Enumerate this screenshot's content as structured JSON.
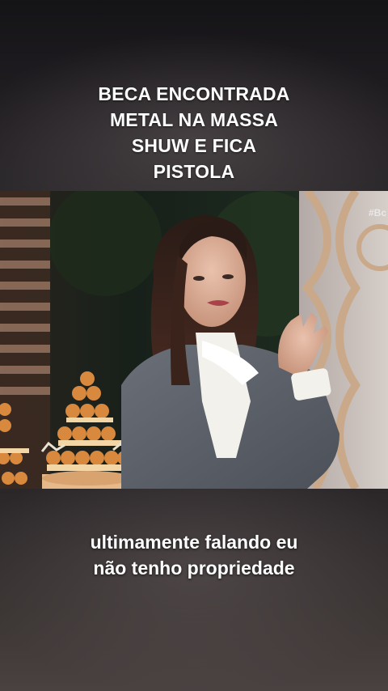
{
  "caption": {
    "lines": [
      "BECA ENCONTRADA",
      "METAL NA MASSA",
      "SHUW E FICA",
      "PISTOLA"
    ]
  },
  "video": {
    "watermark": "#Bc"
  },
  "subtitle": {
    "lines": [
      "ultimamente falando eu",
      "não tenho propriedade"
    ]
  },
  "colors": {
    "caption_text": "#ffffff",
    "background": "#2a2628"
  }
}
